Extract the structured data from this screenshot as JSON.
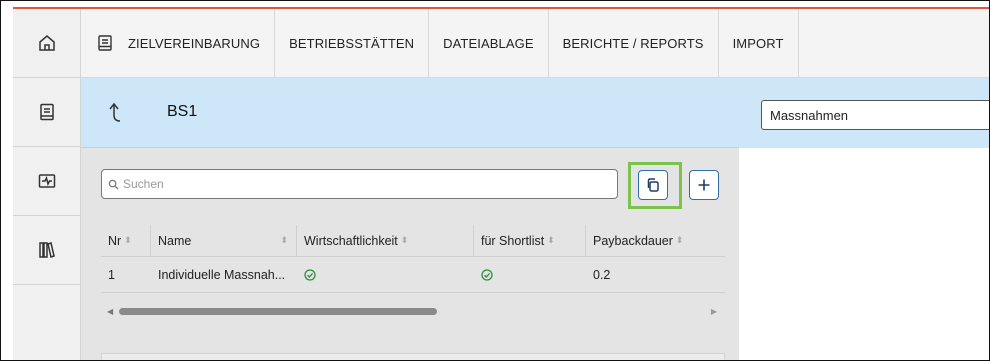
{
  "sidebar": {
    "items": [
      {
        "icon": "home-icon"
      },
      {
        "icon": "notebook-icon"
      },
      {
        "icon": "monitor-pulse-icon"
      },
      {
        "icon": "library-icon"
      }
    ]
  },
  "topnav": {
    "items": [
      {
        "label": "ZIELVEREINBARUNG",
        "icon": "document-icon"
      },
      {
        "label": "BETRIEBSSTÄTTEN"
      },
      {
        "label": "DATEIABLAGE"
      },
      {
        "label": "BERICHTE / REPORTS"
      },
      {
        "label": "IMPORT"
      }
    ]
  },
  "header": {
    "title": "BS1",
    "back_icon": "back-arrow-icon"
  },
  "right_panel": {
    "selected": "Massnahmen"
  },
  "search": {
    "placeholder": "Suchen"
  },
  "actions": {
    "copy_icon": "copy-icon",
    "add_icon": "plus-icon"
  },
  "table": {
    "columns": [
      "Nr",
      "Name",
      "Wirtschaftlichkeit",
      "für Shortlist",
      "Paybackdauer"
    ],
    "rows": [
      {
        "nr": "1",
        "name": "Individuelle Massnah...",
        "wirtschaftlichkeit": "check",
        "shortlist": "check",
        "payback": "0.2"
      }
    ]
  },
  "colors": {
    "accent": "#e2553d",
    "header_bg": "#cde6f8",
    "highlight": "#7bc44c",
    "button_border": "#2f6ea8",
    "check": "#2f8f3a"
  }
}
